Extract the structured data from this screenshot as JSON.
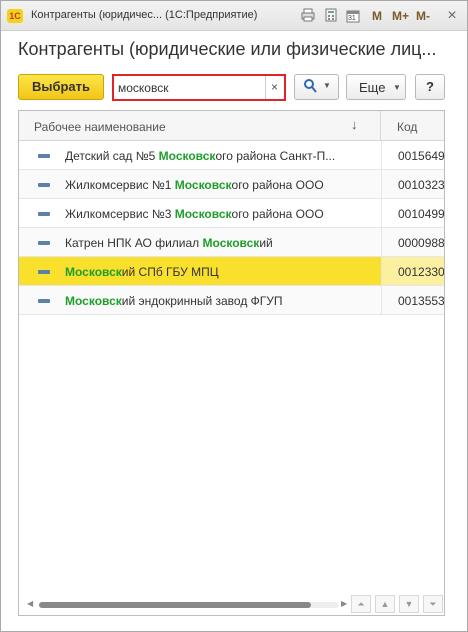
{
  "window": {
    "title": "Контрагенты (юридичес... (1С:Предприятие)",
    "logo": "1С",
    "toolbar_icons": [
      "print-icon",
      "calculator-icon",
      "calendar-icon"
    ],
    "calendar_day": "31",
    "m_buttons": [
      "M",
      "M+",
      "M-"
    ],
    "close": "×"
  },
  "form": {
    "heading": "Контрагенты (юридические или физические лиц..."
  },
  "toolbar": {
    "select_label": "Выбрать",
    "search_value": "московск",
    "search_clear": "×",
    "find_icon": "search-icon",
    "more_label": "Еще",
    "help_label": "?"
  },
  "table": {
    "columns": [
      "Рабочее наименование",
      "Код"
    ],
    "sort_indicator": "↓",
    "rows": [
      {
        "prefix": "Детский сад №5 ",
        "highlight": "Московск",
        "suffix": "ого района Санкт-П...",
        "code": "0015649",
        "selected": false
      },
      {
        "prefix": "Жилкомсервис №1 ",
        "highlight": "Московск",
        "suffix": "ого района ООО",
        "code": "0010323",
        "selected": false
      },
      {
        "prefix": "Жилкомсервис №3 ",
        "highlight": "Московск",
        "suffix": "ого района ООО",
        "code": "0010499",
        "selected": false
      },
      {
        "prefix": "Катрен НПК АО филиал ",
        "highlight": "Московск",
        "suffix": "ий",
        "code": "0000988",
        "selected": false
      },
      {
        "prefix": "",
        "highlight": "Московск",
        "suffix": "ий СПб ГБУ МПЦ",
        "code": "0012330",
        "selected": true
      },
      {
        "prefix": "",
        "highlight": "Московск",
        "suffix": "ий эндокринный завод ФГУП",
        "code": "0013553",
        "selected": false
      }
    ]
  },
  "colors": {
    "accent_yellow": "#f9e02c",
    "highlight_green": "#1f9e2c",
    "search_border": "#e0242a"
  }
}
